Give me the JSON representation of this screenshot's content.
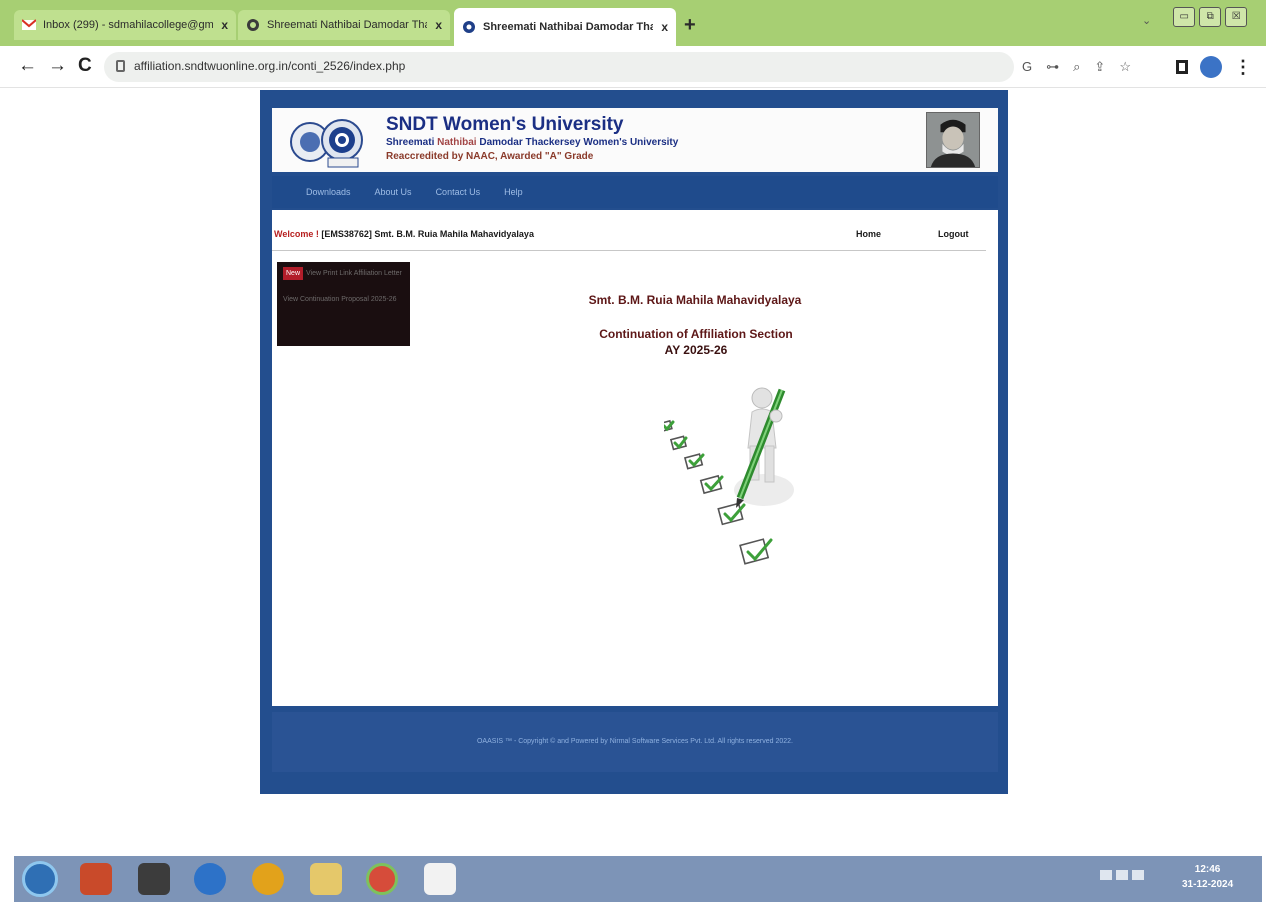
{
  "browser": {
    "tabs": [
      {
        "title": "Inbox (299) - sdmahilacollege@gm",
        "close": "x"
      },
      {
        "title": "Shreemati Nathibai Damodar Tha",
        "close": "x"
      },
      {
        "title": "Shreemati Nathibai Damodar Tha",
        "close": "x"
      }
    ],
    "new_tab": "+",
    "window_buttons": [
      "▭",
      "⧉",
      "☒"
    ],
    "nav": {
      "back": "←",
      "forward": "→",
      "reload": "C"
    },
    "url": "affiliation.sndtwuonline.org.in/conti_2526/index.php",
    "address_icons": [
      "G",
      "⊶",
      "⌕",
      "⇪",
      "☆"
    ],
    "menu_glyph": "⋮"
  },
  "site": {
    "university_name": "SNDT Women's University",
    "full_name_prefix": "Shreemati",
    "full_name_highlight": "Nathibai",
    "full_name_suffix": "Damodar Thackersey Women's University",
    "accreditation": "Reaccredited by NAAC, Awarded \"A\" Grade",
    "menu": [
      "Downloads",
      "About Us",
      "Contact Us",
      "Help"
    ],
    "welcome_label": "Welcome !",
    "welcome_user": "[EMS38762] Smt. B.M. Ruia Mahila Mahavidyalaya",
    "home": "Home",
    "logout": "Logout",
    "side_menu": {
      "badge": "New",
      "item1": "View Print Link Affiliation Letter",
      "item2": "View Continuation Proposal 2025-26"
    },
    "college_name": "Smt. B.M. Ruia Mahila Mahavidyalaya",
    "section_title": "Continuation of Affiliation Section",
    "academic_year": "AY 2025-26",
    "footer": "OAASIS ™ - Copyright © and Powered by Nirmal Software Services Pvt. Ltd. All rights reserved 2022."
  },
  "taskbar": {
    "time": "12:46",
    "date": "31-12-2024"
  },
  "colors": {
    "tab_strip": "#a7cf73",
    "page_frame": "#234e8e",
    "brand_text": "#1b2f84",
    "heading_text": "#5d1717",
    "taskbar": "#7d94b7"
  }
}
